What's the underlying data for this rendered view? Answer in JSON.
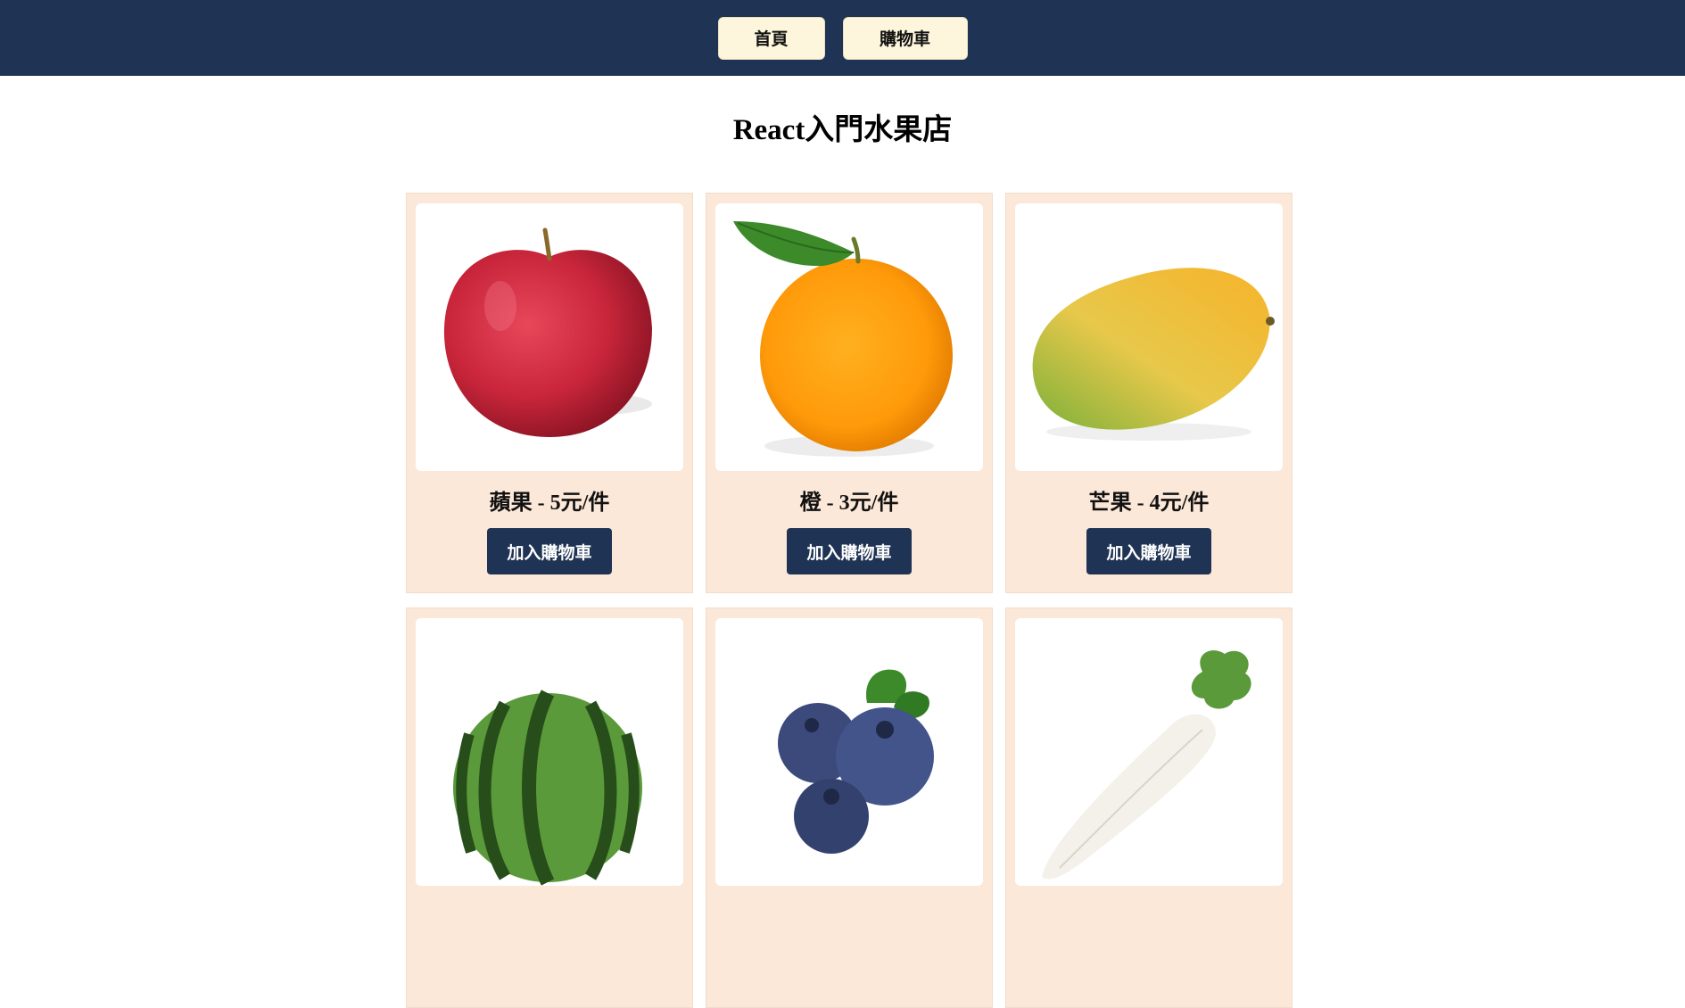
{
  "nav": {
    "home_label": "首頁",
    "cart_label": "購物車"
  },
  "page": {
    "title": "React入門水果店"
  },
  "products": [
    {
      "label": "蘋果 - 5元/件",
      "button": "加入購物車",
      "icon": "apple-image"
    },
    {
      "label": "橙 - 3元/件",
      "button": "加入購物車",
      "icon": "orange-image"
    },
    {
      "label": "芒果 - 4元/件",
      "button": "加入購物車",
      "icon": "mango-image"
    },
    {
      "label": "",
      "button": "",
      "icon": "watermelon-image"
    },
    {
      "label": "",
      "button": "",
      "icon": "blueberry-image"
    },
    {
      "label": "",
      "button": "",
      "icon": "radish-image"
    }
  ],
  "colors": {
    "navbar": "#1f3354",
    "nav_button": "#fdf6dc",
    "card": "#fbe8d8",
    "add_button": "#1f3354"
  }
}
